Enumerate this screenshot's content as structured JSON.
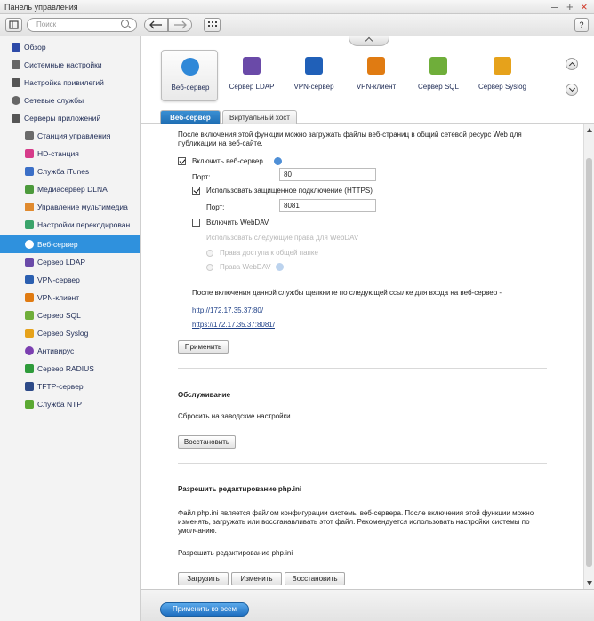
{
  "window": {
    "title": "Панель управления",
    "controls": [
      "–",
      "+",
      "×"
    ]
  },
  "toolbar": {
    "search_placeholder": "Поиск",
    "help_label": "?"
  },
  "sidebar": {
    "items": [
      {
        "label": "Обзор",
        "icon": "overview-icon",
        "level": 0,
        "color": "#2d4aa8"
      },
      {
        "label": "Системные настройки",
        "icon": "gear-icon",
        "level": 0,
        "color": "#666666"
      },
      {
        "label": "Настройка привилегий",
        "icon": "user-icon",
        "level": 0,
        "color": "#555555"
      },
      {
        "label": "Сетевые службы",
        "icon": "network-icon",
        "level": 0,
        "color": "#666666"
      },
      {
        "label": "Серверы приложений",
        "icon": "app-servers-icon",
        "level": 0,
        "color": "#555555"
      },
      {
        "label": "Станция управления",
        "icon": "station-icon",
        "level": 1,
        "color": "#6a6a6a"
      },
      {
        "label": "HD-станция",
        "icon": "hd-station-icon",
        "level": 1,
        "color": "#d63b8a"
      },
      {
        "label": "Служба iTunes",
        "icon": "itunes-icon",
        "level": 1,
        "color": "#3b6fc7"
      },
      {
        "label": "Медиасервер DLNA",
        "icon": "dlna-icon",
        "level": 1,
        "color": "#4c9a3c"
      },
      {
        "label": "Управление мультимедиа",
        "icon": "multimedia-icon",
        "level": 1,
        "color": "#e08a2e"
      },
      {
        "label": "Настройки перекодирован..",
        "icon": "transcode-icon",
        "level": 1,
        "color": "#3aa36a"
      },
      {
        "label": "Веб-сервер",
        "icon": "globe-icon",
        "level": 1,
        "color": "#2f7fd0",
        "active": true
      },
      {
        "label": "Сервер LDAP",
        "icon": "ldap-icon",
        "level": 1,
        "color": "#6a4aa8"
      },
      {
        "label": "VPN-сервер",
        "icon": "vpn-server-icon",
        "level": 1,
        "color": "#2b5fb0"
      },
      {
        "label": "VPN-клиент",
        "icon": "vpn-client-icon",
        "level": 1,
        "color": "#e07b12"
      },
      {
        "label": "Сервер SQL",
        "icon": "sql-icon",
        "level": 1,
        "color": "#6fae3a"
      },
      {
        "label": "Сервер Syslog",
        "icon": "syslog-icon",
        "level": 1,
        "color": "#e6a21b"
      },
      {
        "label": "Антивирус",
        "icon": "antivirus-icon",
        "level": 1,
        "color": "#7b3fb0"
      },
      {
        "label": "Сервер RADIUS",
        "icon": "radius-icon",
        "level": 1,
        "color": "#2e9b3a"
      },
      {
        "label": "TFTP-сервер",
        "icon": "tftp-icon",
        "level": 1,
        "color": "#2d4a88"
      },
      {
        "label": "Служба NTP",
        "icon": "ntp-icon",
        "level": 1,
        "color": "#5aa832"
      }
    ]
  },
  "apps": [
    {
      "label": "Веб-сервер",
      "icon": "globe-icon",
      "color": "#2f88d8",
      "selected": true
    },
    {
      "label": "Сервер LDAP",
      "icon": "ldap-icon",
      "color": "#6a4aa8"
    },
    {
      "label": "VPN-сервер",
      "icon": "vpn-server-icon",
      "color": "#2060b8"
    },
    {
      "label": "VPN-клиент",
      "icon": "vpn-client-icon",
      "color": "#e07b12"
    },
    {
      "label": "Сервер SQL",
      "icon": "sql-icon",
      "color": "#6fae3a"
    },
    {
      "label": "Сервер Syslog",
      "icon": "syslog-icon",
      "color": "#e6a21b"
    }
  ],
  "tabs": [
    {
      "label": "Веб-сервер",
      "active": true
    },
    {
      "label": "Виртуальный хост",
      "active": false
    }
  ],
  "web": {
    "intro": "После включения этой функции можно загружать файлы веб-страниц в общий сетевой ресурс Web для публикации на веб-сайте.",
    "enable_label": "Включить веб-сервер",
    "enable_checked": true,
    "port_label": "Порт:",
    "port_value": "80",
    "https_label": "Использовать защищенное подключение (HTTPS)",
    "https_checked": true,
    "https_port_label": "Порт:",
    "https_port_value": "8081",
    "webdav_label": "Включить WebDAV",
    "webdav_checked": false,
    "webdav_rights_label": "Использовать следующие права для WebDAV",
    "webdav_option1": "Права доступа к общей папке",
    "webdav_option2": "Права WebDAV",
    "after_enable_text": "После включения данной службы щелкните по следующей ссылке для входа на веб-сервер -",
    "link_http": "http://172.17.35.37:80/",
    "link_https": "https://172.17.35.37:8081/",
    "apply_label": "Применить"
  },
  "maintenance": {
    "title": "Обслуживание",
    "reset_text": "Сбросить на заводские настройки",
    "restore_label": "Восстановить"
  },
  "php": {
    "title": "Разрешить редактирование php.ini",
    "description": "Файл php.ini является файлом конфигурации системы веб-сервера. После включения этой функции можно изменять, загружать или восстанавливать этот файл. Рекомендуется использовать настройки системы по умолчанию.",
    "allow_label": "Разрешить редактирование php.ini",
    "upload_label": "Загрузить",
    "edit_label": "Изменить",
    "restore_label": "Восстановить"
  },
  "footer": {
    "apply_all_label": "Применить ко всем"
  }
}
